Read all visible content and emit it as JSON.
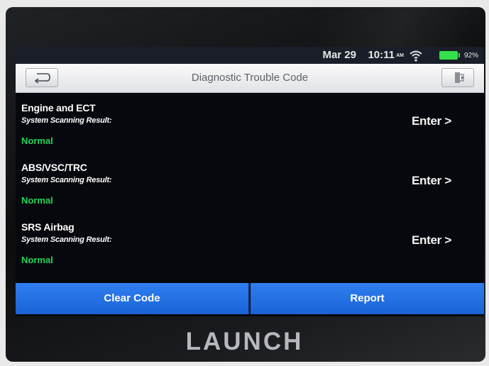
{
  "status_bar": {
    "date": "Mar 29",
    "time": "10:11",
    "ampm": "AM",
    "battery_percent": "92%",
    "icons": [
      "wifi-icon",
      "battery-icon"
    ]
  },
  "header": {
    "title": "Diagnostic Trouble Code",
    "back_icon": "back-arrow-icon",
    "exit_icon": "exit-icon"
  },
  "systems": [
    {
      "name": "Engine and ECT",
      "result_label": "System Scanning Result:",
      "status": "Normal",
      "action": "Enter >"
    },
    {
      "name": "ABS/VSC/TRC",
      "result_label": "System Scanning Result:",
      "status": "Normal",
      "action": "Enter >"
    },
    {
      "name": "SRS Airbag",
      "result_label": "System Scanning Result:",
      "status": "Normal",
      "action": "Enter >"
    }
  ],
  "footer": {
    "clear_code": "Clear Code",
    "report": "Report"
  },
  "brand": "LAUNCH",
  "colors": {
    "status_ok": "#22d35a",
    "button_blue": "#2f7ff0",
    "battery": "#34e04a"
  }
}
